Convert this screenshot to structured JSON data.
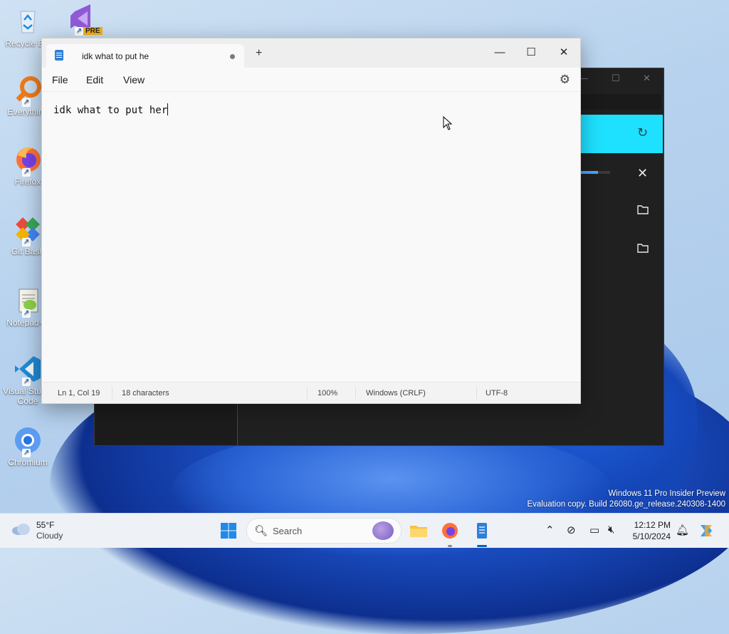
{
  "desktop": {
    "icons": [
      {
        "label": "Recycle Bin"
      },
      {
        "label": "Everything"
      },
      {
        "label": "Firefox"
      },
      {
        "label": "Git Bash"
      },
      {
        "label": "Notepad++"
      },
      {
        "label": "Visual Studio Code"
      },
      {
        "label": "Chromium"
      }
    ],
    "vs_badge": "PRE",
    "watermark_line1": "Windows 11 Pro Insider Preview",
    "watermark_line2": "Evaluation copy. Build 26080.ge_release.240308-1400"
  },
  "background_window": {
    "progress_fraction": 0.6
  },
  "notepad": {
    "tab_title": "idk what to put he",
    "new_tab_symbol": "+",
    "menu": {
      "file": "File",
      "edit": "Edit",
      "view": "View"
    },
    "content": "idk what to put her",
    "status": {
      "position": "Ln 1, Col 19",
      "characters": "18 characters",
      "zoom": "100%",
      "line_ending": "Windows (CRLF)",
      "encoding": "UTF-8"
    },
    "controls": {
      "minimize": "—",
      "maximize": "☐",
      "close": "✕"
    }
  },
  "taskbar": {
    "weather_temp": "55°F",
    "weather_condition": "Cloudy",
    "search_placeholder": "Search",
    "clock_time": "12:12 PM",
    "clock_date": "5/10/2024"
  }
}
